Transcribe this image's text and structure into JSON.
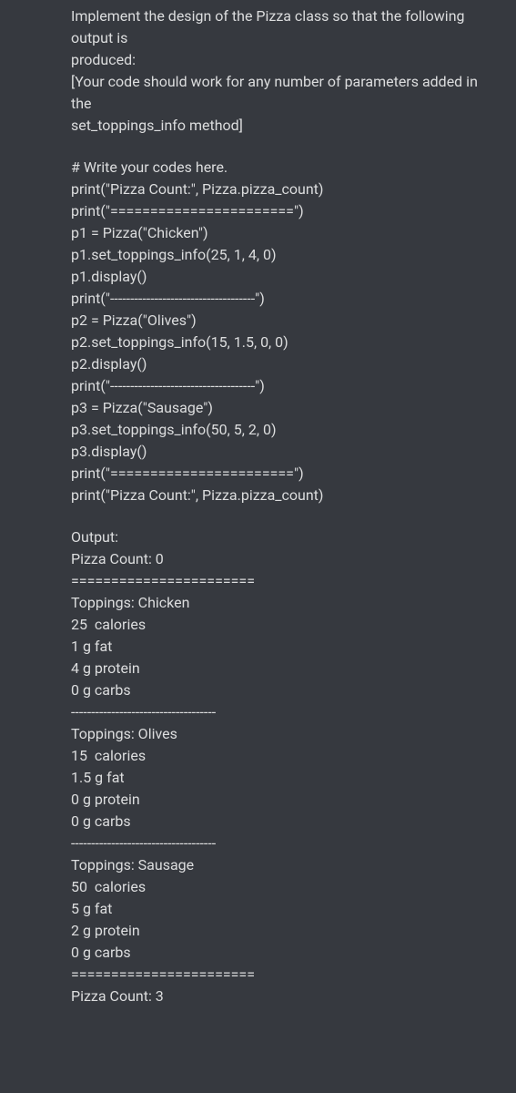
{
  "lines": [
    "Implement the design of the Pizza class so that the following output is",
    "produced:",
    "[Your code should work for any number of parameters added in the",
    "set_toppings_info method]",
    "",
    "# Write your codes here.",
    "print(\"Pizza Count:\", Pizza.pizza_count)",
    "print(\"=======================\")",
    "p1 = Pizza(\"Chicken\")",
    "p1.set_toppings_info(25, 1, 4, 0)",
    "p1.display()",
    "print(\"------------------------------------\")",
    "p2 = Pizza(\"Olives\")",
    "p2.set_toppings_info(15, 1.5, 0, 0)",
    "p2.display()",
    "print(\"------------------------------------\")",
    "p3 = Pizza(\"Sausage\")",
    "p3.set_toppings_info(50, 5, 2, 0)",
    "p3.display()",
    "print(\"=======================\")",
    "print(\"Pizza Count:\", Pizza.pizza_count)",
    "",
    "Output:",
    "Pizza Count: 0",
    "=======================",
    "Toppings: Chicken",
    "25  calories",
    "1 g fat",
    "4 g protein",
    "0 g carbs",
    "------------------------------------",
    "Toppings: Olives",
    "15  calories",
    "1.5 g fat",
    "0 g protein",
    "0 g carbs",
    "------------------------------------",
    "Toppings: Sausage",
    "50  calories",
    "5 g fat",
    "2 g protein",
    "0 g carbs",
    "=======================",
    "Pizza Count: 3"
  ]
}
